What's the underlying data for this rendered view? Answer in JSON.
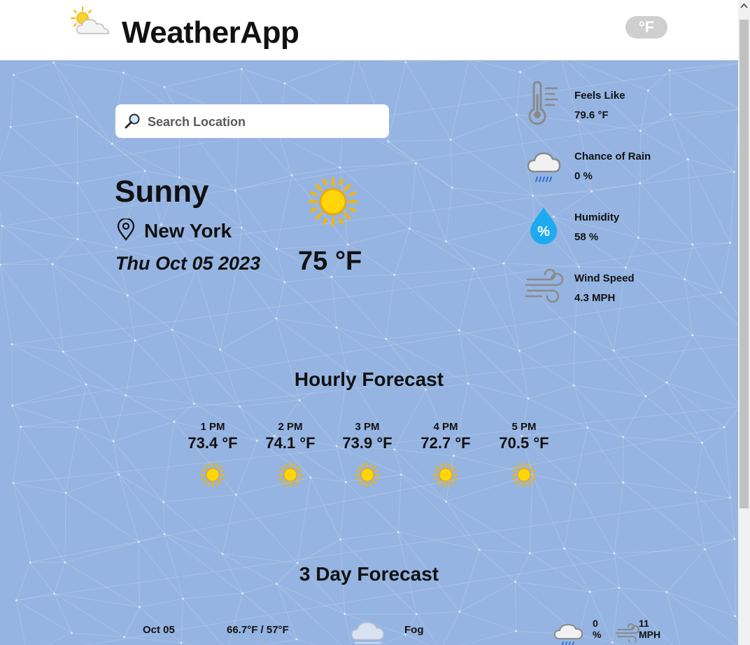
{
  "app": {
    "title": "WeatherApp",
    "unit_toggle": "°F"
  },
  "search": {
    "placeholder": "Search Location",
    "value": ""
  },
  "current": {
    "condition": "Sunny",
    "location": "New York",
    "date": "Thu Oct 05 2023",
    "temperature": "75 °F",
    "icon": "sun-icon"
  },
  "stats": [
    {
      "label": "Feels Like",
      "value": "79.6 °F",
      "icon": "thermometer-icon"
    },
    {
      "label": "Chance of Rain",
      "value": "0 %",
      "icon": "rain-cloud-icon"
    },
    {
      "label": "Humidity",
      "value": "58 %",
      "icon": "humidity-drop-icon"
    },
    {
      "label": "Wind Speed",
      "value": "4.3 MPH",
      "icon": "wind-icon"
    }
  ],
  "hourly": {
    "title": "Hourly Forecast",
    "items": [
      {
        "time": "1 PM",
        "temp": "73.4 °F",
        "icon": "sun-icon"
      },
      {
        "time": "2 PM",
        "temp": "74.1 °F",
        "icon": "sun-icon"
      },
      {
        "time": "3 PM",
        "temp": "73.9 °F",
        "icon": "sun-icon"
      },
      {
        "time": "4 PM",
        "temp": "72.7 °F",
        "icon": "sun-icon"
      },
      {
        "time": "5 PM",
        "temp": "70.5 °F",
        "icon": "sun-icon"
      }
    ]
  },
  "daily": {
    "title": "3 Day Forecast",
    "items": [
      {
        "date": "Oct 05",
        "temps": "66.7°F / 57°F",
        "condition": "Fog",
        "icon": "fog-cloud-icon",
        "rain": "0",
        "rain_unit": "%",
        "wind": "11",
        "wind_unit": "MPH"
      }
    ]
  },
  "colors": {
    "background": "#95b4e1",
    "sun": "#f5c200",
    "humidity": "#1eaaf1"
  }
}
